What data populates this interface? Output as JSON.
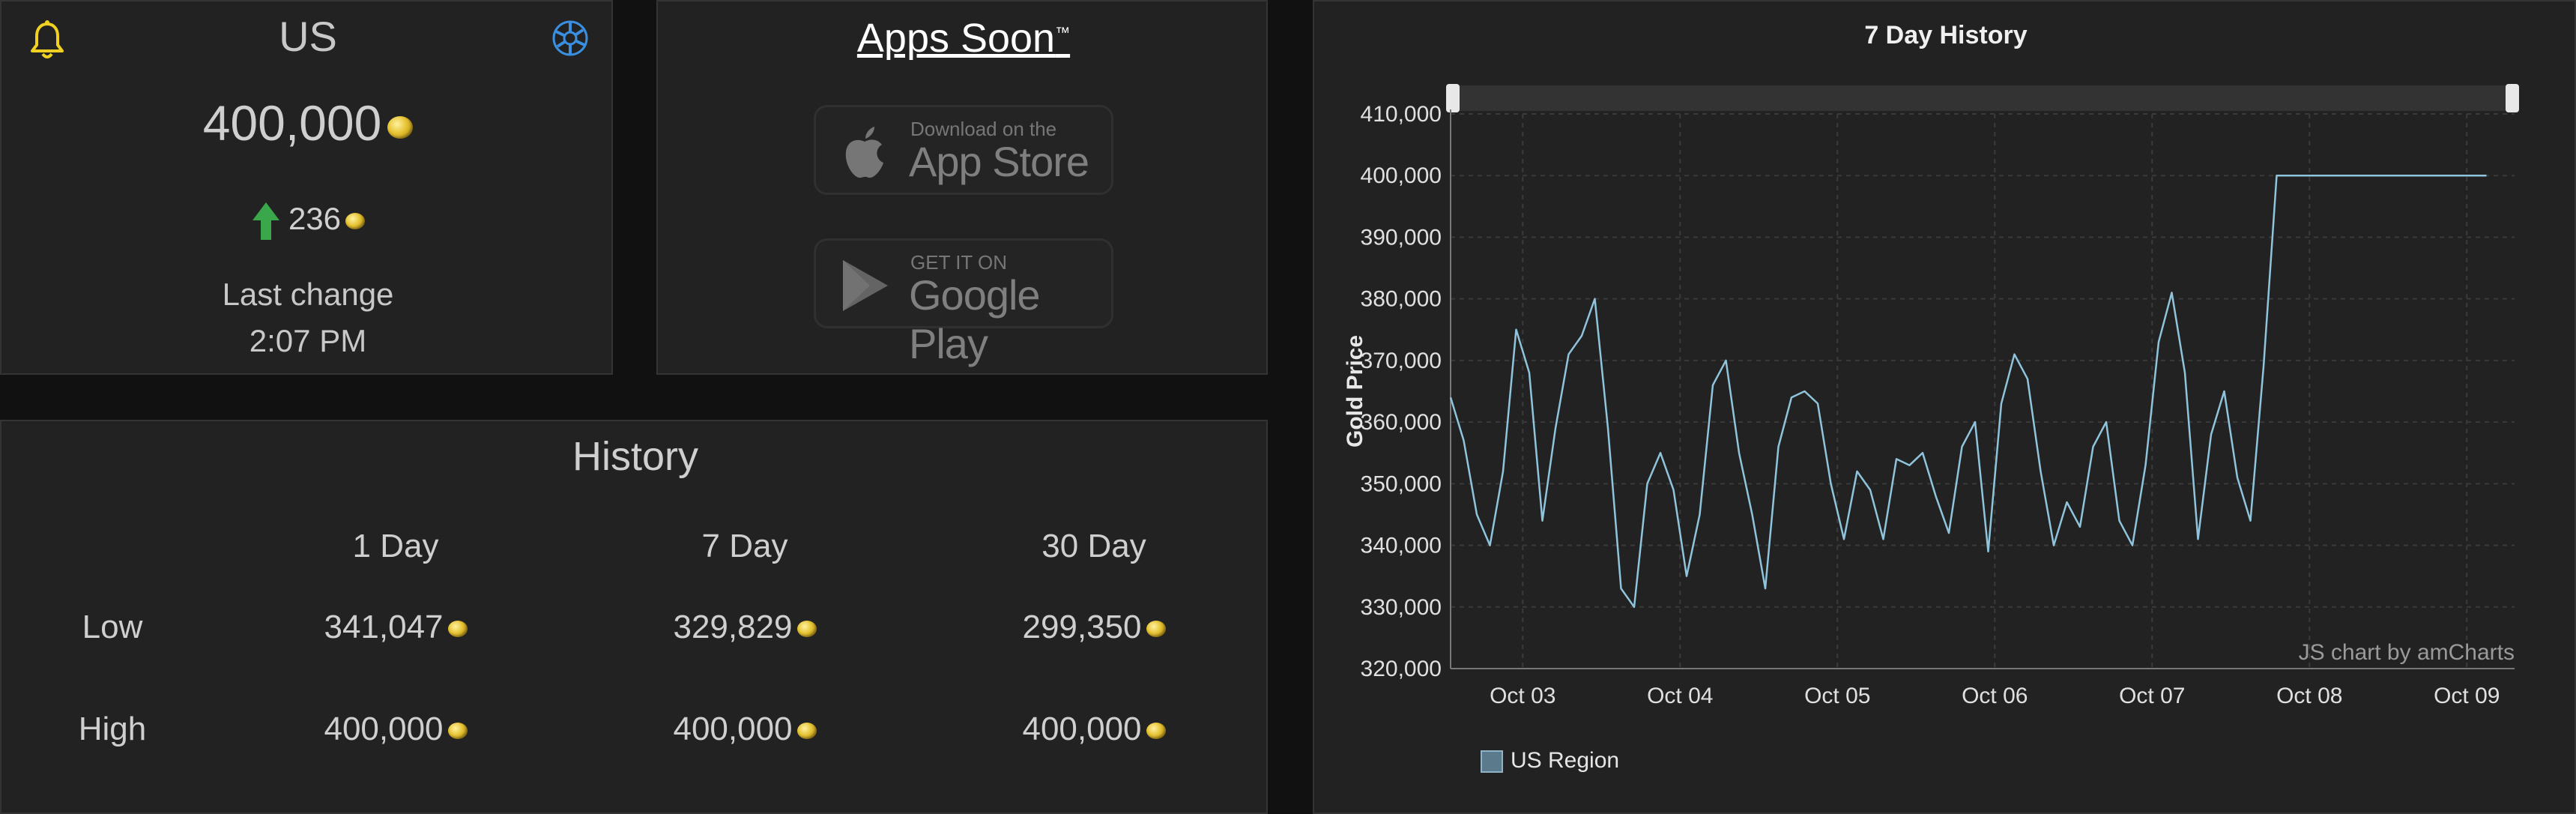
{
  "price_card": {
    "region": "US",
    "price": "400,000",
    "change": "236",
    "last_change_label": "Last change",
    "last_change_time": "2:07 PM",
    "icons": [
      "bell-icon",
      "region-logo-icon",
      "up-arrow-icon",
      "gold-coin-icon"
    ],
    "colors": {
      "bell": "#f0d020",
      "up_arrow": "#3aa84a",
      "region_logo": "#3b8fe0"
    }
  },
  "apps": {
    "title": "Apps Soon",
    "trademark": "™",
    "appstore": {
      "small": "Download on the",
      "big": "App Store",
      "icon": "apple-icon"
    },
    "googleplay": {
      "small": "GET IT ON",
      "big": "Google Play",
      "icon": "play-icon"
    }
  },
  "history": {
    "title": "History",
    "columns": [
      "1 Day",
      "7 Day",
      "30 Day"
    ],
    "rows": [
      {
        "label": "Low",
        "values": [
          "341,047",
          "329,829",
          "299,350"
        ]
      },
      {
        "label": "High",
        "values": [
          "400,000",
          "400,000",
          "400,000"
        ]
      }
    ]
  },
  "chart_data": {
    "type": "line",
    "title": "7 Day History",
    "xlabel": "",
    "ylabel": "Gold Price",
    "ylim": [
      320000,
      410000
    ],
    "y_ticks": [
      "320,000",
      "330,000",
      "340,000",
      "350,000",
      "360,000",
      "370,000",
      "380,000",
      "390,000",
      "400,000",
      "410,000"
    ],
    "x_ticks": [
      "Oct 03",
      "Oct 04",
      "Oct 05",
      "Oct 06",
      "Oct 07",
      "Oct 08",
      "Oct 09"
    ],
    "grid": true,
    "legend_position": "bottom-left",
    "credit": "JS chart by amCharts",
    "series": [
      {
        "name": "US Region",
        "color": "#8fc4dc",
        "x": [
          "Oct 02 13:00",
          "Oct 02 15:00",
          "Oct 02 17:00",
          "Oct 02 19:00",
          "Oct 02 21:00",
          "Oct 02 23:00",
          "Oct 03 01:00",
          "Oct 03 03:00",
          "Oct 03 05:00",
          "Oct 03 07:00",
          "Oct 03 09:00",
          "Oct 03 11:00",
          "Oct 03 13:00",
          "Oct 03 15:00",
          "Oct 03 17:00",
          "Oct 03 19:00",
          "Oct 03 21:00",
          "Oct 03 23:00",
          "Oct 04 01:00",
          "Oct 04 03:00",
          "Oct 04 05:00",
          "Oct 04 07:00",
          "Oct 04 09:00",
          "Oct 04 11:00",
          "Oct 04 13:00",
          "Oct 04 15:00",
          "Oct 04 17:00",
          "Oct 04 19:00",
          "Oct 04 21:00",
          "Oct 04 23:00",
          "Oct 05 01:00",
          "Oct 05 03:00",
          "Oct 05 05:00",
          "Oct 05 07:00",
          "Oct 05 09:00",
          "Oct 05 11:00",
          "Oct 05 13:00",
          "Oct 05 15:00",
          "Oct 05 17:00",
          "Oct 05 19:00",
          "Oct 05 21:00",
          "Oct 05 23:00",
          "Oct 06 01:00",
          "Oct 06 03:00",
          "Oct 06 05:00",
          "Oct 06 07:00",
          "Oct 06 09:00",
          "Oct 06 11:00",
          "Oct 06 13:00",
          "Oct 06 15:00",
          "Oct 06 17:00",
          "Oct 06 19:00",
          "Oct 06 21:00",
          "Oct 06 23:00",
          "Oct 07 01:00",
          "Oct 07 03:00",
          "Oct 07 05:00",
          "Oct 07 07:00",
          "Oct 07 09:00",
          "Oct 07 11:00",
          "Oct 07 13:00",
          "Oct 07 15:00",
          "Oct 07 17:00",
          "Oct 07 19:00",
          "Oct 07 21:00",
          "Oct 07 23:00",
          "Oct 08 01:00",
          "Oct 08 03:00",
          "Oct 08 05:00",
          "Oct 08 07:00",
          "Oct 08 09:00",
          "Oct 08 11:00",
          "Oct 08 13:00",
          "Oct 08 15:00",
          "Oct 08 17:00",
          "Oct 08 19:00",
          "Oct 08 21:00",
          "Oct 08 23:00",
          "Oct 09 01:00",
          "Oct 09 03:00"
        ],
        "values": [
          364000,
          357000,
          345000,
          340000,
          352000,
          375000,
          368000,
          344000,
          359000,
          371000,
          374000,
          380000,
          359000,
          333000,
          330000,
          350000,
          355000,
          349000,
          335000,
          345000,
          366000,
          370000,
          355000,
          345000,
          333000,
          356000,
          364000,
          365000,
          363000,
          350000,
          341000,
          352000,
          349000,
          341000,
          354000,
          353000,
          355000,
          348000,
          342000,
          356000,
          360000,
          339000,
          363000,
          371000,
          367000,
          352000,
          340000,
          347000,
          343000,
          356000,
          360000,
          344000,
          340000,
          353000,
          373000,
          381000,
          368000,
          341000,
          358000,
          365000,
          351000,
          344000,
          369000,
          400000,
          400000,
          400000,
          400000,
          400000,
          400000,
          400000,
          400000,
          400000,
          400000,
          400000,
          400000,
          400000,
          400000,
          400000,
          400000,
          400000
        ]
      }
    ]
  }
}
